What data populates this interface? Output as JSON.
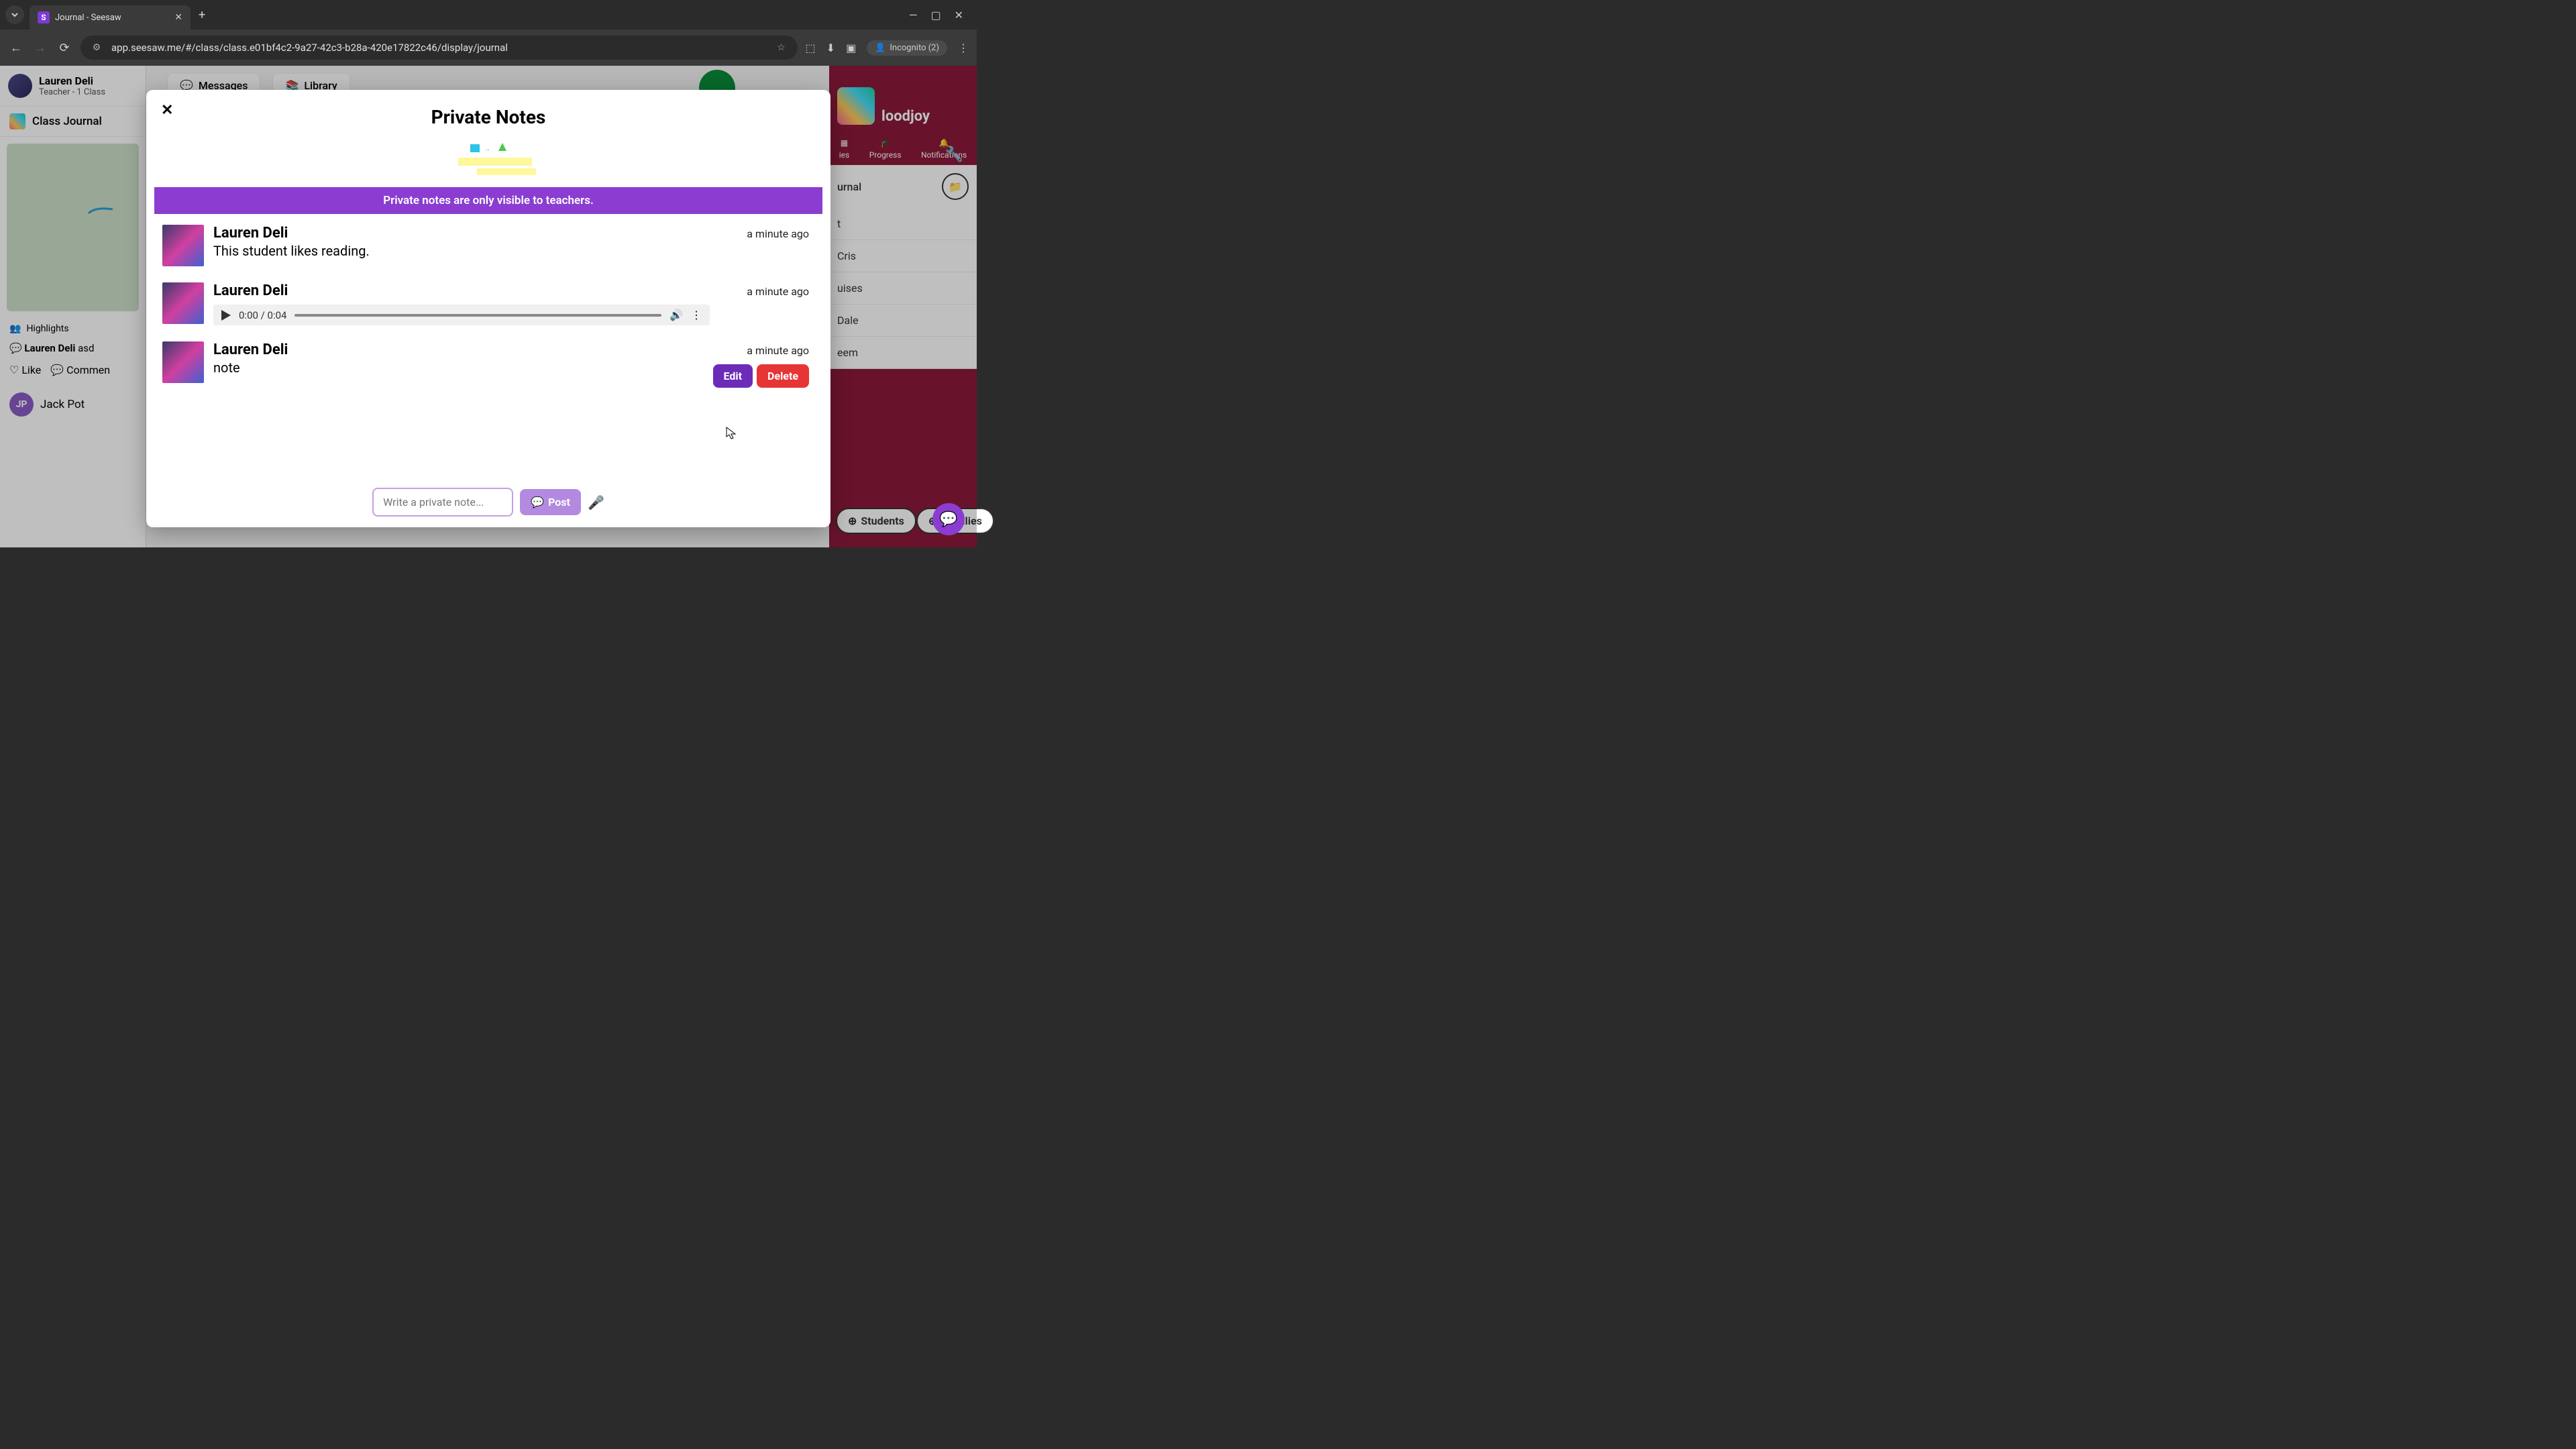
{
  "browser": {
    "tab_title": "Journal - Seesaw",
    "url": "app.seesaw.me/#/class/class.e01bf4c2-9a27-42c3-b28a-420e17822c46/display/journal",
    "incognito_label": "Incognito (2)"
  },
  "user": {
    "name": "Lauren Deli",
    "role": "Teacher - 1 Class"
  },
  "class_journal_label": "Class Journal",
  "highlights_label": "Highlights",
  "comment_preview_author": "Lauren Deli",
  "comment_preview_text": "asd",
  "like_label": "Like",
  "comment_label": "Commen",
  "jp": {
    "initials": "JP",
    "name": "Jack Pot"
  },
  "toolbar": {
    "messages": "Messages",
    "library": "Library"
  },
  "right": {
    "class": "loodjoy",
    "tab_ies": "ies",
    "tab_progress": "Progress",
    "tab_notifications": "Notifications",
    "journal": "urnal",
    "items": [
      "t",
      "Cris",
      "uises",
      "Dale",
      "eem"
    ],
    "students_btn": "Students",
    "families_btn": "Families"
  },
  "modal": {
    "title": "Private Notes",
    "banner": "Private notes are only visible to teachers.",
    "notes": [
      {
        "author": "Lauren Deli",
        "text": "This student likes reading.",
        "time": "a minute ago"
      },
      {
        "author": "Lauren Deli",
        "audio_time": "0:00 / 0:04",
        "time": "a minute ago"
      },
      {
        "author": "Lauren Deli",
        "text": "note",
        "time": "a minute ago"
      }
    ],
    "edit_label": "Edit",
    "delete_label": "Delete",
    "input_placeholder": "Write a private note...",
    "post_label": "Post"
  }
}
